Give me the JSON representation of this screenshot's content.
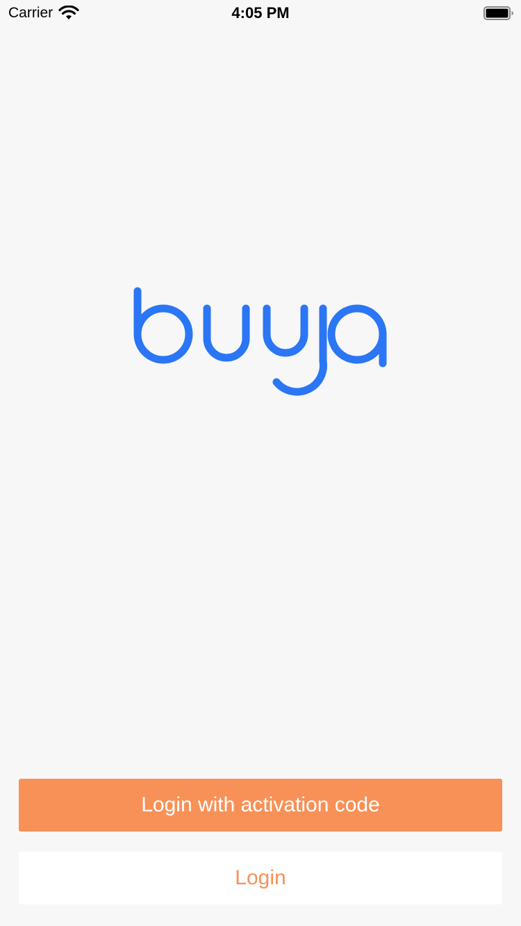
{
  "status_bar": {
    "carrier": "Carrier",
    "time": "4:05 PM",
    "wifi_icon": "wifi-icon",
    "battery_icon": "battery-full-icon"
  },
  "logo": {
    "text": "buya",
    "color": "#2a76f5"
  },
  "actions": {
    "activation_label": "Login with activation code",
    "login_label": "Login",
    "accent_color": "#f89157"
  }
}
